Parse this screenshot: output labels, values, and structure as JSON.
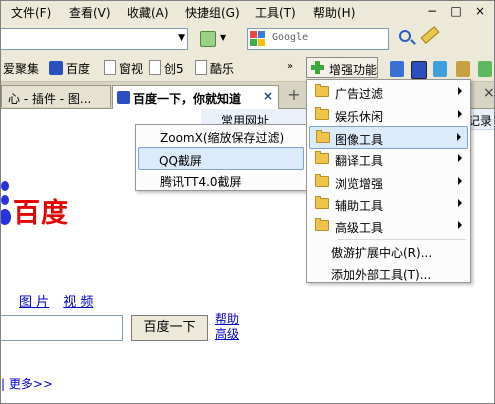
{
  "menubar": {
    "items": [
      "文件(F)",
      "查看(V)",
      "收藏(A)",
      "快捷组(G)",
      "工具(T)",
      "帮助(H)"
    ],
    "window_buttons": [
      "−",
      "□",
      "×"
    ]
  },
  "search": {
    "placeholder": "Google"
  },
  "bookmarks": [
    "爱聚集",
    "百度",
    "窗视",
    "创5",
    "酷乐"
  ],
  "enhance_button": {
    "label": "增强功能"
  },
  "tabs": [
    {
      "label": "心 - 插件 - 图..."
    },
    {
      "label": "百度一下，你就知道"
    }
  ],
  "strip": {
    "text": "常用网址",
    "right": "记录"
  },
  "page": {
    "logo_text": "百度",
    "links": [
      "图 片",
      "视 频"
    ],
    "search_button": "百度一下",
    "side_links": [
      "帮助",
      "高级"
    ],
    "more": "| 更多>>"
  },
  "submenu": {
    "items": [
      "ZoomX(缩放保存过滤)",
      "QQ截屏",
      "腾讯TT4.0截屏"
    ]
  },
  "enhance_menu": {
    "folders": [
      "广告过滤",
      "娱乐休闲",
      "图像工具",
      "翻译工具",
      "浏览增强",
      "辅助工具",
      "高级工具"
    ],
    "items": [
      "傲游扩展中心(R)...",
      "添加外部工具(T)..."
    ]
  },
  "colors": {
    "baidu_red": "#e10602",
    "baidu_blue": "#2932e1",
    "highlight": "#dcebfc"
  }
}
